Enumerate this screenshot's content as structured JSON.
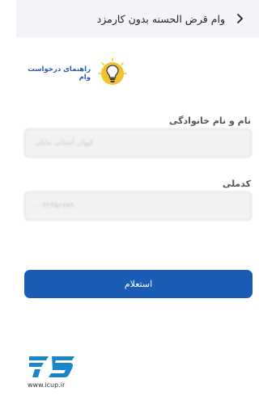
{
  "header": {
    "title": "وام قرض الحسنه بدون کارمزد",
    "back_icon": "chevron-right-icon"
  },
  "help": {
    "label": "راهنمای درخواست وام",
    "icon": "lightbulb-icon",
    "icon_color": "#f2c12e"
  },
  "form": {
    "name_label": "نام و نام خانوادگی",
    "name_value": "کیوان آستانی مایلی",
    "national_id_label": "کدملی",
    "national_id_value": "۰۰۳۲۴۵۶۷۸۹"
  },
  "submit": {
    "label": "استعلام",
    "color": "#1a5bb6"
  },
  "brand": {
    "url": "www.icup.ir",
    "color": "#1a86c9"
  }
}
